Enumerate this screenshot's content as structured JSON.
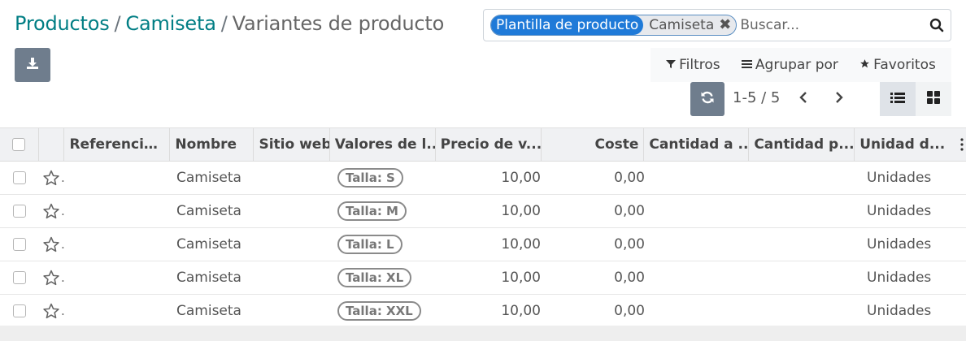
{
  "breadcrumb": {
    "items": [
      "Productos",
      "Camiseta"
    ],
    "separator": "/",
    "current": "Variantes de producto"
  },
  "search": {
    "facet_label": "Plantilla de producto",
    "facet_value": "Camiseta",
    "placeholder": "Buscar..."
  },
  "filters": {
    "filter_label": "Filtros",
    "group_label": "Agrupar por",
    "favorites_label": "Favoritos"
  },
  "pager": {
    "value": "1-5 / 5"
  },
  "table": {
    "columns": [
      "Referencia i...",
      "Nombre",
      "Sitio web",
      "Valores de l...",
      "Precio de v...",
      "Coste",
      "Cantidad a ...",
      "Cantidad p...",
      "Unidad d..."
    ],
    "rows": [
      {
        "ref": "",
        "name": "Camiseta",
        "website": "",
        "attribute": "Talla: S",
        "price": "10,00",
        "cost": "0,00",
        "qty_hand": "",
        "qty_forecast": "",
        "uom": "Unidades"
      },
      {
        "ref": "",
        "name": "Camiseta",
        "website": "",
        "attribute": "Talla: M",
        "price": "10,00",
        "cost": "0,00",
        "qty_hand": "",
        "qty_forecast": "",
        "uom": "Unidades"
      },
      {
        "ref": "",
        "name": "Camiseta",
        "website": "",
        "attribute": "Talla: L",
        "price": "10,00",
        "cost": "0,00",
        "qty_hand": "",
        "qty_forecast": "",
        "uom": "Unidades"
      },
      {
        "ref": "",
        "name": "Camiseta",
        "website": "",
        "attribute": "Talla: XL",
        "price": "10,00",
        "cost": "0,00",
        "qty_hand": "",
        "qty_forecast": "",
        "uom": "Unidades"
      },
      {
        "ref": "",
        "name": "Camiseta",
        "website": "",
        "attribute": "Talla: XXL",
        "price": "10,00",
        "cost": "0,00",
        "qty_hand": "",
        "qty_forecast": "",
        "uom": "Unidades"
      }
    ]
  },
  "icons": {
    "search": "search-icon",
    "remove_facet": "close-icon",
    "download": "download-icon",
    "filter": "filter-icon",
    "group": "bars-icon",
    "favorites": "star-icon",
    "refresh": "refresh-icon",
    "prev": "chevron-left-icon",
    "next": "chevron-right-icon",
    "list_view": "list-icon",
    "kanban_view": "grid-icon",
    "row_favorite": "star-outline-icon"
  },
  "colors": {
    "brand_link": "#017e84",
    "facet_blue": "#1f7ad8",
    "button_gray": "#6f7d8d",
    "header_bg": "#f0f1f3"
  }
}
